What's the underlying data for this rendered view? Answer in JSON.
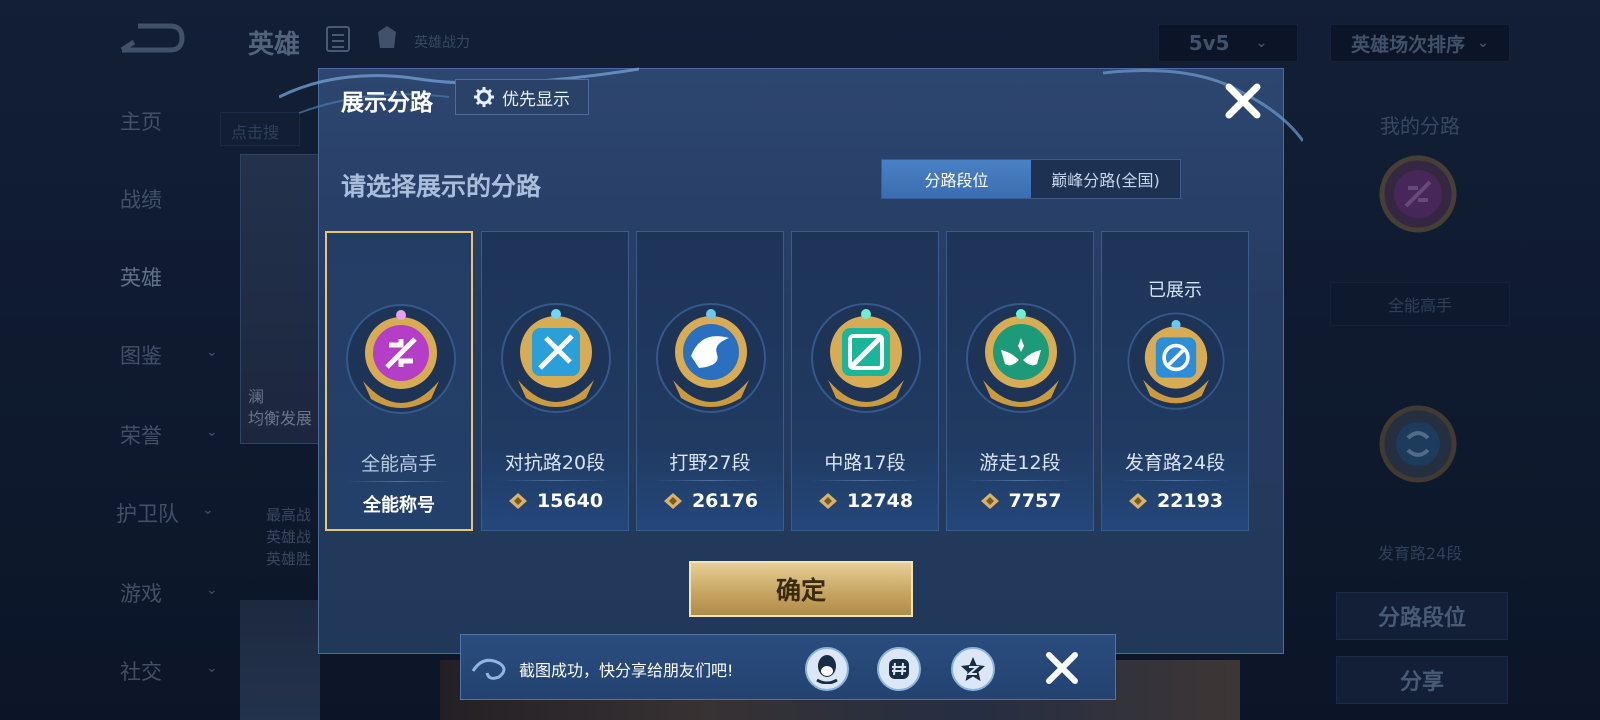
{
  "background": {
    "page_title": "英雄",
    "power_label": "英雄战力",
    "mode_select": "5v5",
    "sort_select": "英雄场次排序",
    "nav": [
      {
        "label": "主页",
        "has_chevron": false
      },
      {
        "label": "战绩",
        "has_chevron": false
      },
      {
        "label": "英雄",
        "has_chevron": false,
        "active": true
      },
      {
        "label": "图鉴",
        "has_chevron": true
      },
      {
        "label": "荣誉",
        "has_chevron": true
      },
      {
        "label": "护卫队",
        "has_chevron": true
      },
      {
        "label": "游戏",
        "has_chevron": true
      },
      {
        "label": "社交",
        "has_chevron": true
      }
    ],
    "search_hint": "点击搜",
    "hero_name": "澜",
    "hero_subtitle": "均衡发展",
    "hero_stats": [
      "最高战",
      "英雄战",
      "英雄胜"
    ],
    "right": {
      "my_lane_title": "我的分路",
      "label_top": "全能高手",
      "label_bottom": "发育路24段",
      "btn_lane_rank": "分路段位",
      "btn_share": "分享"
    }
  },
  "dialog": {
    "title": "展示分路",
    "priority_button": "优先显示",
    "prompt": "请选择展示的分路",
    "tabs": [
      {
        "label": "分路段位",
        "active": true
      },
      {
        "label": "巅峰分路(全国)",
        "active": false
      }
    ],
    "lanes": [
      {
        "name": "全能高手",
        "value": "全能称号",
        "selected": true,
        "shown": false,
        "color": "#b43ec7"
      },
      {
        "name": "对抗路20段",
        "value": "15640",
        "selected": false,
        "shown": false,
        "color": "#2a9fd8"
      },
      {
        "name": "打野27段",
        "value": "26176",
        "selected": false,
        "shown": false,
        "color": "#2b6fc0"
      },
      {
        "name": "中路17段",
        "value": "12748",
        "selected": false,
        "shown": false,
        "color": "#1bb59a"
      },
      {
        "name": "游走12段",
        "value": "7757",
        "selected": false,
        "shown": false,
        "color": "#1d9a78"
      },
      {
        "name": "发育路24段",
        "value": "22193",
        "selected": false,
        "shown": true,
        "color": "#2c8ed8"
      }
    ],
    "shown_label": "已展示",
    "confirm": "确定"
  },
  "toast": {
    "text": "截图成功，快分享给朋友们吧!",
    "icons": [
      "qq-icon",
      "wechat-moments-icon",
      "qzone-icon"
    ]
  },
  "colors": {
    "gold": "#e8c477",
    "dialog_bg": "#2d4670",
    "accent_blue": "#3a6eb0"
  }
}
